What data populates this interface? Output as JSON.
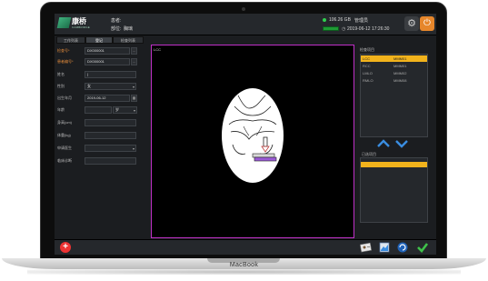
{
  "device": {
    "brand": "MacBook"
  },
  "header": {
    "logo_text": "康桥",
    "logo_sub": "CAMBRIDGE",
    "patient_label": "患者:",
    "exam_label": "部位:",
    "exam_value": "胸璃",
    "disk_free": "106.26 GB",
    "user": "管理员",
    "datetime": "2019-06-12 17:26:30"
  },
  "tabs": [
    {
      "label": "工作列表",
      "active": false
    },
    {
      "label": "登记",
      "active": true
    },
    {
      "label": "检查列表",
      "active": false
    }
  ],
  "form": {
    "fields": [
      {
        "label": "检查号*",
        "value": "DX000001",
        "required": true,
        "button": "..."
      },
      {
        "label": "患者编号*",
        "value": "DX000001",
        "required": true,
        "button": "..."
      },
      {
        "label": "姓名",
        "value": "|",
        "required": false,
        "button": ""
      },
      {
        "label": "性别",
        "value": "女",
        "required": false,
        "select": true
      },
      {
        "label": "出生年月",
        "value": "2019-06-12",
        "required": false,
        "button": "▦"
      },
      {
        "label": "年龄",
        "value": "",
        "required": false,
        "unit": "岁"
      },
      {
        "label": "身高(cm)",
        "value": "",
        "required": false
      },
      {
        "label": "体重(kg)",
        "value": "",
        "required": false
      },
      {
        "label": "申请医生",
        "value": "",
        "required": false,
        "select": true
      },
      {
        "label": "临床诊断",
        "value": "",
        "required": false
      }
    ]
  },
  "viewer": {
    "tag": "LCC"
  },
  "right_panel": {
    "list_title": "检查项目",
    "items": [
      {
        "code": "LCC",
        "name": "MMM01",
        "selected": true
      },
      {
        "code": "RCC",
        "name": "MMM01",
        "selected": false
      },
      {
        "code": "LMLO",
        "name": "MMM02",
        "selected": false
      },
      {
        "code": "RMLO",
        "name": "MMM08",
        "selected": false
      }
    ],
    "selected_title": "已选项目"
  },
  "colors": {
    "accent": "#f2b31c",
    "viewer_border": "#c030c8",
    "required_label": "#e28a3a",
    "add_button": "#ee3333"
  },
  "footer_icons": [
    "add-icon",
    "patient-card-icon",
    "image-card-icon",
    "refresh-icon",
    "confirm-icon"
  ]
}
